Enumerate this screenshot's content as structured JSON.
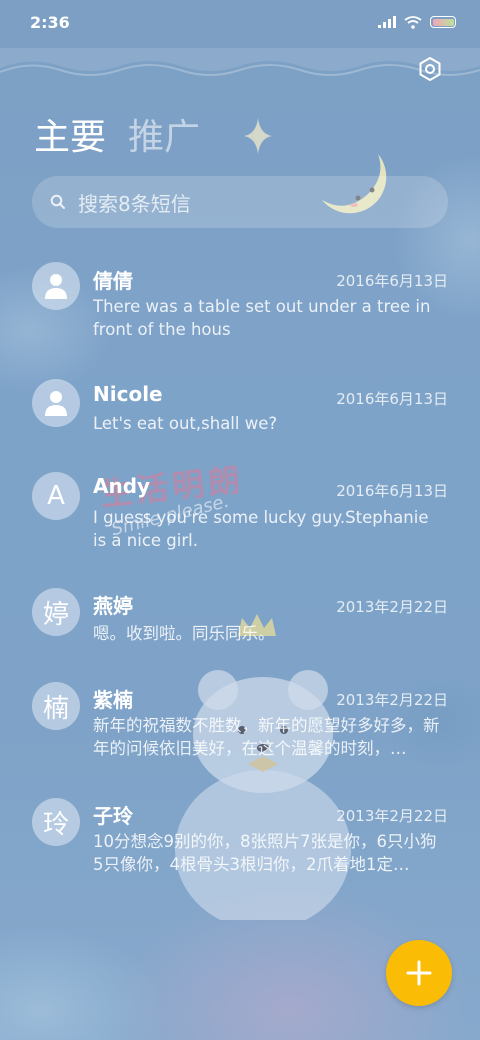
{
  "status_bar": {
    "time": "2:36",
    "icons": [
      "signal-icon",
      "wifi-icon",
      "battery-icon"
    ],
    "battery_colors": [
      "#f5a3b8",
      "#b9e39a"
    ]
  },
  "header": {
    "settings_icon": "gear-icon",
    "tabs": [
      {
        "label": "主要",
        "active": true
      },
      {
        "label": "推广",
        "active": false
      }
    ]
  },
  "search": {
    "placeholder": "搜索8条短信",
    "icon": "search-icon"
  },
  "wallpaper": {
    "watermark_text": "生活明朗",
    "watermark_sub": "Smile please."
  },
  "conversations": [
    {
      "avatar": "",
      "avatar_icon": "person-icon",
      "name": "倩倩",
      "date": "2016年6月13日",
      "preview": "There was a table set out under a tree in front of the hous"
    },
    {
      "avatar": "",
      "avatar_icon": "person-icon",
      "name": "Nicole",
      "date": "2016年6月13日",
      "preview": "Let's eat out,shall we?"
    },
    {
      "avatar": "A",
      "avatar_icon": "",
      "name": "Andy",
      "date": "2016年6月13日",
      "preview": "I guess you're some lucky guy.Stephanie is a nice girl."
    },
    {
      "avatar": "婷",
      "avatar_icon": "",
      "name": "燕婷",
      "date": "2013年2月22日",
      "preview": "嗯。收到啦。同乐同乐。"
    },
    {
      "avatar": "楠",
      "avatar_icon": "",
      "name": "紫楠",
      "date": "2013年2月22日",
      "preview": "新年的祝福数不胜数，新年的愿望好多好多，新年的问候依旧美好，在这个温馨的时刻，…"
    },
    {
      "avatar": "玲",
      "avatar_icon": "",
      "name": "子玲",
      "date": "2013年2月22日",
      "preview": "10分想念9别的你，8张照片7张是你，6只小狗5只像你，4根骨头3根归你，2爪着地1定…"
    }
  ],
  "fab": {
    "icon": "plus-icon",
    "color": "#fbbc05"
  }
}
